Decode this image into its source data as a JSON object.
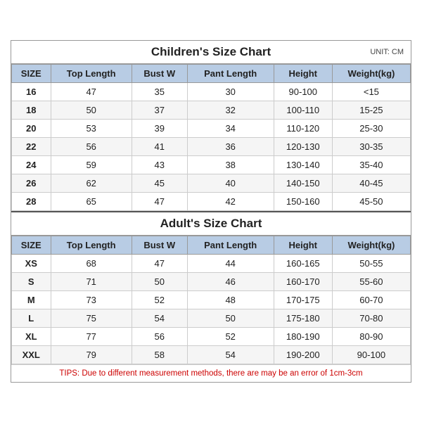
{
  "children_chart": {
    "title": "Children's Size Chart",
    "unit": "UNIT: CM",
    "headers": [
      "SIZE",
      "Top Length",
      "Bust W",
      "Pant Length",
      "Height",
      "Weight(kg)"
    ],
    "rows": [
      [
        "16",
        "47",
        "35",
        "30",
        "90-100",
        "<15"
      ],
      [
        "18",
        "50",
        "37",
        "32",
        "100-110",
        "15-25"
      ],
      [
        "20",
        "53",
        "39",
        "34",
        "110-120",
        "25-30"
      ],
      [
        "22",
        "56",
        "41",
        "36",
        "120-130",
        "30-35"
      ],
      [
        "24",
        "59",
        "43",
        "38",
        "130-140",
        "35-40"
      ],
      [
        "26",
        "62",
        "45",
        "40",
        "140-150",
        "40-45"
      ],
      [
        "28",
        "65",
        "47",
        "42",
        "150-160",
        "45-50"
      ]
    ]
  },
  "adult_chart": {
    "title": "Adult's Size Chart",
    "headers": [
      "SIZE",
      "Top Length",
      "Bust W",
      "Pant Length",
      "Height",
      "Weight(kg)"
    ],
    "rows": [
      [
        "XS",
        "68",
        "47",
        "44",
        "160-165",
        "50-55"
      ],
      [
        "S",
        "71",
        "50",
        "46",
        "160-170",
        "55-60"
      ],
      [
        "M",
        "73",
        "52",
        "48",
        "170-175",
        "60-70"
      ],
      [
        "L",
        "75",
        "54",
        "50",
        "175-180",
        "70-80"
      ],
      [
        "XL",
        "77",
        "56",
        "52",
        "180-190",
        "80-90"
      ],
      [
        "XXL",
        "79",
        "58",
        "54",
        "190-200",
        "90-100"
      ]
    ]
  },
  "tips": "TIPS: Due to different measurement methods, there are may be an error of 1cm-3cm"
}
